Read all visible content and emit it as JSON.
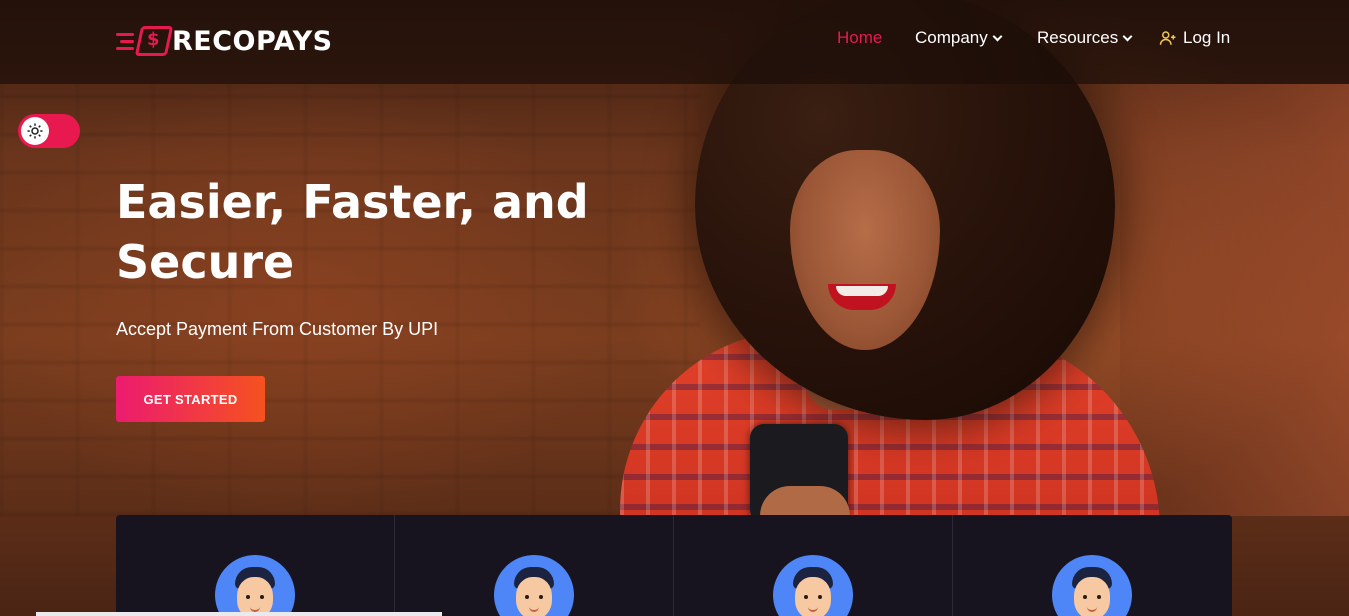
{
  "brand": {
    "name": "RECOPAYS",
    "logo_icon": "dollar-wallet-icon",
    "accent": "#e8194e"
  },
  "nav": {
    "items": [
      {
        "label": "Home",
        "active": true
      },
      {
        "label": "Company",
        "dropdown": true
      },
      {
        "label": "Resources",
        "dropdown": true
      },
      {
        "label": "Log In",
        "icon": "user-plus-icon"
      }
    ]
  },
  "theme_toggle": {
    "icon": "sun-icon",
    "state": "light"
  },
  "hero": {
    "title_line1": "Easier, Faster, and",
    "title_line2": "Secure",
    "subtitle": "Accept Payment From Customer By UPI",
    "cta_label": "GET STARTED",
    "cta_gradient": [
      "#ec1b6f",
      "#f5521f"
    ]
  },
  "cards": {
    "count": 4,
    "avatar_icon": "person-avatar-icon",
    "avatar_bg": "#4f86f7",
    "panel_bg": "#171420"
  }
}
